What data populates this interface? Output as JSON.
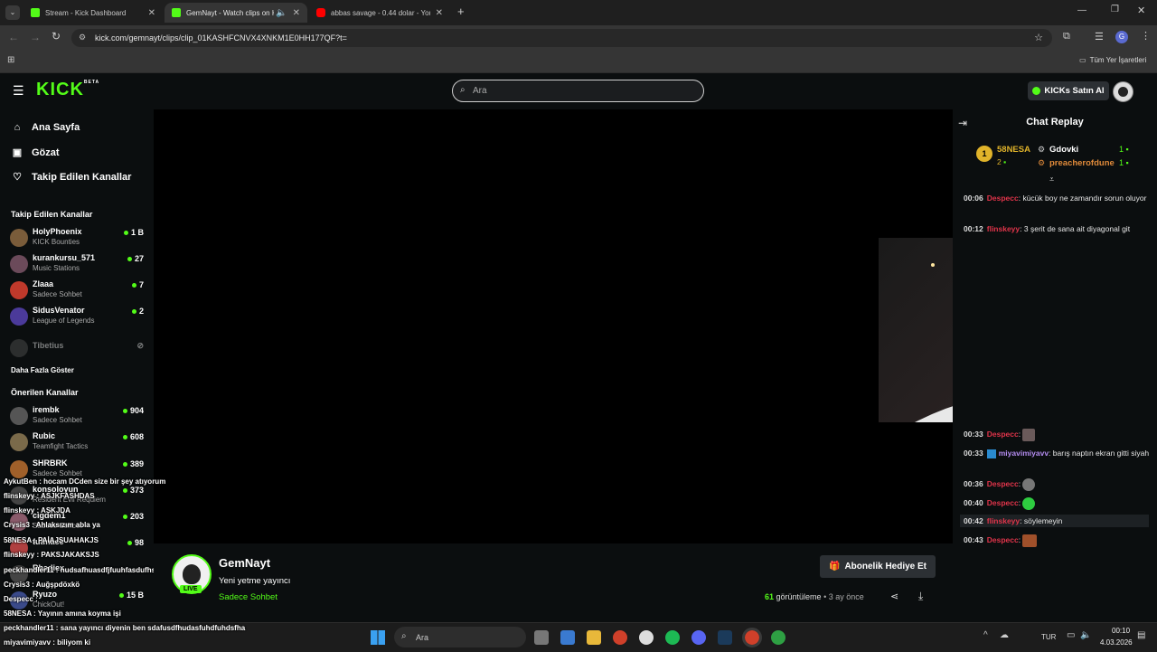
{
  "browser": {
    "tabs": [
      {
        "title": "Stream - Kick Dashboard",
        "favicon_color": "#53fc18",
        "active": false
      },
      {
        "title": "GemNayt - Watch clips on K",
        "favicon_color": "#53fc18",
        "active": true
      },
      {
        "title": "abbas savage - 0.44 dolar - You",
        "favicon_color": "#ff0000",
        "active": false
      }
    ],
    "new_tab": "+",
    "url": "kick.com/gemnayt/clips/clip_01KASHFCNVX4XNKM1E0HH177QF?t=",
    "bookmarks_folder": "Tüm Yer İşaretleri"
  },
  "kick": {
    "logo": "KICK",
    "logo_badge": "BETA",
    "search_placeholder": "Ara",
    "buy_kicks": "KICKs Satın Al",
    "accent": "#53fc18"
  },
  "sidebar": {
    "nav": [
      {
        "label": "Ana Sayfa",
        "icon": "home-icon",
        "glyph": "⌂"
      },
      {
        "label": "Gözat",
        "icon": "browse-icon",
        "glyph": "▣"
      },
      {
        "label": "Takip Edilen Kanallar",
        "icon": "heart-icon",
        "glyph": "♡"
      }
    ],
    "followed_header": "Takip Edilen Kanallar",
    "followed": [
      {
        "name": "HolyPhoenix",
        "sub": "KICK Bounties",
        "viewers": "1 B",
        "color": "#7a5c3a"
      },
      {
        "name": "kurankursu_571",
        "sub": "Music Stations",
        "viewers": "27",
        "color": "#6b4a5a"
      },
      {
        "name": "Zlaaa",
        "sub": "Sadece Sohbet",
        "viewers": "7",
        "color": "#c0392b"
      },
      {
        "name": "SidusVenator",
        "sub": "League of Legends",
        "viewers": "2",
        "color": "#4b3a9a"
      }
    ],
    "offline": {
      "name": "Tibetius"
    },
    "show_more": "Daha Fazla Göster",
    "recommended_header": "Önerilen Kanallar",
    "recommended": [
      {
        "name": "irembk",
        "sub": "Sadece Sohbet",
        "viewers": "904",
        "color": "#555"
      },
      {
        "name": "Rubic",
        "sub": "Teamfight Tactics",
        "viewers": "608",
        "color": "#7a6a4a"
      },
      {
        "name": "SHRBRK",
        "sub": "Sadece Sohbet",
        "viewers": "389",
        "color": "#a0602a"
      },
      {
        "name": "konsoloyun",
        "sub": "Resident Evil Requiem",
        "viewers": "373",
        "color": "#444"
      },
      {
        "name": "cigdem1",
        "sub": "Sadece Sohbet",
        "viewers": "203",
        "color": "#8a5a6a"
      },
      {
        "name": "tutmacc",
        "sub": "",
        "viewers": "98",
        "color": "#b04040"
      },
      {
        "name": "Rhadiex",
        "sub": "",
        "viewers": "",
        "color": "#444"
      },
      {
        "name": "Ryuzo",
        "sub": "ChickOut!",
        "viewers": "15 B",
        "color": "#3a4a8a"
      }
    ]
  },
  "stream_overlay": [
    "AykutBen : hocam DCden size bir şey atıyorum",
    "flinskeyy : ASJKFASHDAS",
    "flinskeyy : ASKJDA",
    "Crysis3 : Ahlaksızım abla ya",
    "58NESA : PAİAJSUAHAKJS",
    "flinskeyy : PAKSJAKAKSJS",
    "peckhandler11 : hudsafhuasdfjfuuhfasdufhs",
    "Crysis3 : Auğşpdöxkö",
    "Despecc :",
    "58NESA : Yayının amına koyma işi",
    "peckhandler11 : sana yayıncı diyenin ben sdafusdfhudasfuhdfuhdsfha",
    "miyavimiyavv : biliyom ki"
  ],
  "channel": {
    "name": "GemNayt",
    "title": "Yeni yetme yayıncı",
    "category": "Sadece Sohbet",
    "live_badge": "LIVE",
    "gift_button": "Abonelik Hediye Et",
    "views_count": "61",
    "views_label": "görüntüleme",
    "age": "3 ay önce"
  },
  "chat": {
    "title": "Chat Replay",
    "leaderboard": {
      "first": {
        "rank": "1",
        "name": "58NESA",
        "count": "2"
      },
      "second": {
        "name": "Gdovki",
        "count": "1"
      },
      "third": {
        "name": "preacherofdune",
        "count": "1"
      }
    },
    "messages": [
      {
        "time": "00:06",
        "user": "Despecc",
        "color": "#e0344a",
        "text": "kücük boy ne zamandır sorun oluyor"
      },
      {
        "time": "00:12",
        "user": "flinskeyy",
        "color": "#e0344a",
        "text": "3 şerit de sana ait diyagonal git"
      },
      {
        "time": "00:33",
        "user": "Despecc",
        "color": "#e0344a",
        "text": ""
      },
      {
        "time": "00:33",
        "user": "miyavimiyavv",
        "color": "#b48cf0",
        "text": "barış naptın ekran gitti siyah"
      },
      {
        "time": "00:36",
        "user": "Despecc",
        "color": "#e0344a",
        "text": ""
      },
      {
        "time": "00:40",
        "user": "Despecc",
        "color": "#e0344a",
        "text": ""
      },
      {
        "time": "00:42",
        "user": "flinskeyy",
        "color": "#e0344a",
        "text": "söylemeyin"
      },
      {
        "time": "00:43",
        "user": "Despecc",
        "color": "#e0344a",
        "text": ""
      }
    ]
  },
  "taskbar": {
    "search": "Ara",
    "lang": "TUR",
    "time": "00:10",
    "date": "4.03.2026"
  }
}
